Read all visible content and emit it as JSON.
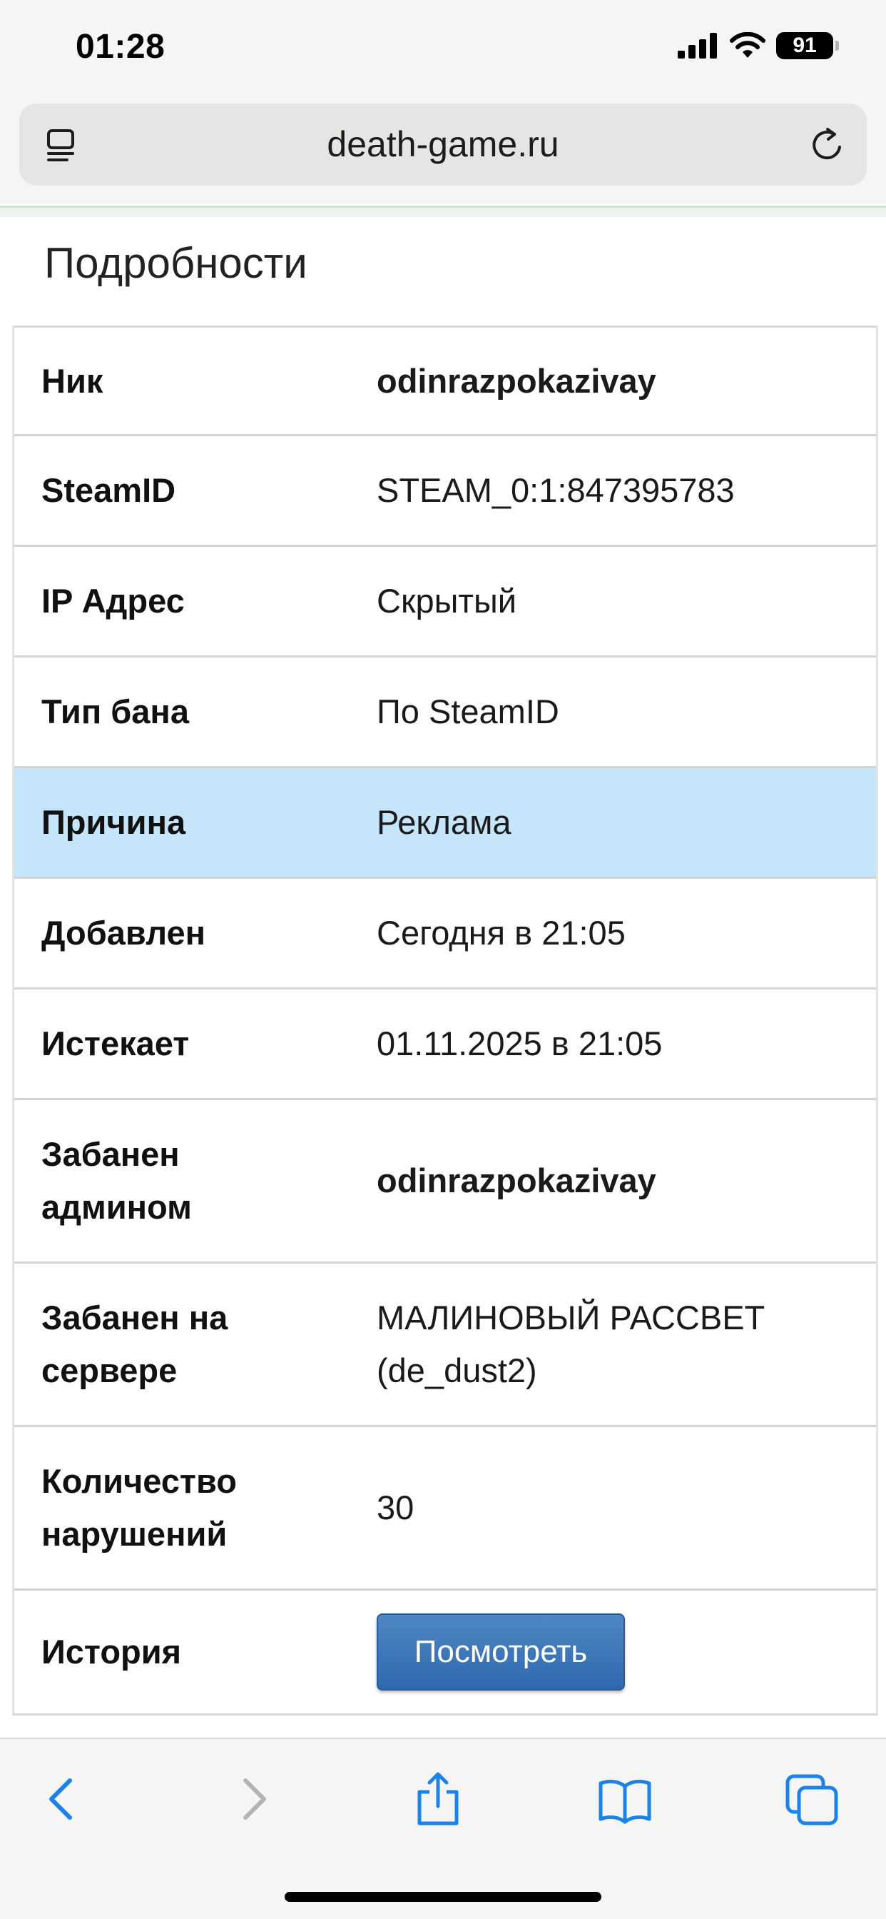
{
  "status_bar": {
    "time": "01:28",
    "battery": "91"
  },
  "browser": {
    "url": "death-game.ru"
  },
  "page": {
    "title": "Подробности",
    "rows": [
      {
        "label": "Ник",
        "value": "odinrazpokazivay"
      },
      {
        "label": "SteamID",
        "value": "STEAM_0:1:847395783"
      },
      {
        "label": "IP Адрес",
        "value": "Скрытый"
      },
      {
        "label": "Тип бана",
        "value": "По SteamID"
      },
      {
        "label": "Причина",
        "value": "Реклама"
      },
      {
        "label": "Добавлен",
        "value": "Сегодня в 21:05"
      },
      {
        "label": "Истекает",
        "value": "01.11.2025 в 21:05"
      },
      {
        "label_line1": "Забанен",
        "label_line2": "админом",
        "value": "odinrazpokazivay"
      },
      {
        "label_line1": "Забанен на",
        "label_line2": "сервере",
        "value_line1": "МАЛИНОВЫЙ РАССВЕТ",
        "value_line2": "(de_dust2)"
      },
      {
        "label_line1": "Количество",
        "label_line2": "нарушений",
        "value": "30"
      },
      {
        "label": "История",
        "button": "Посмотреть"
      }
    ]
  },
  "colors": {
    "highlight_row": "#c5e6fa",
    "button_blue": "#3a74b8",
    "link_blue": "#1a82e8"
  },
  "icons": {
    "status": [
      "cellular-signal-icon",
      "wifi-icon",
      "battery-icon"
    ],
    "url_bar": [
      "reader-mode-icon",
      "reload-icon"
    ],
    "toolbar": [
      "back-icon",
      "forward-icon",
      "share-icon",
      "bookmarks-icon",
      "tabs-icon"
    ]
  }
}
